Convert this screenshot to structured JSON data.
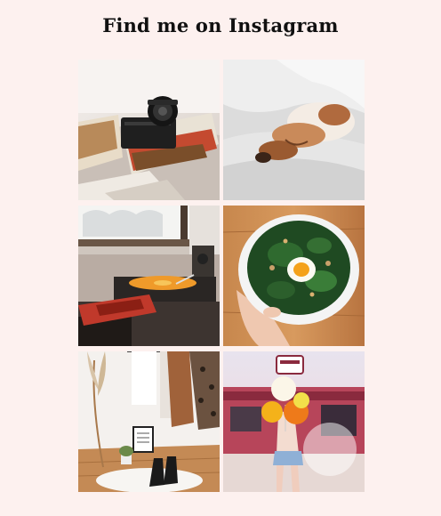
{
  "heading": "Find me on Instagram",
  "photos": [
    {
      "subject": "camera-on-books",
      "link": "instagram-post-1"
    },
    {
      "subject": "dog-sleeping-on-bed",
      "link": "instagram-post-2"
    },
    {
      "subject": "record-player-by-window",
      "link": "instagram-post-3"
    },
    {
      "subject": "salad-bowl-with-egg",
      "link": "instagram-post-4"
    },
    {
      "subject": "wardrobe-and-boots",
      "link": "instagram-post-5"
    },
    {
      "subject": "woman-with-balloons",
      "link": "instagram-post-6"
    }
  ],
  "colors": {
    "background": "#fdf1ef",
    "heading": "#111111"
  }
}
